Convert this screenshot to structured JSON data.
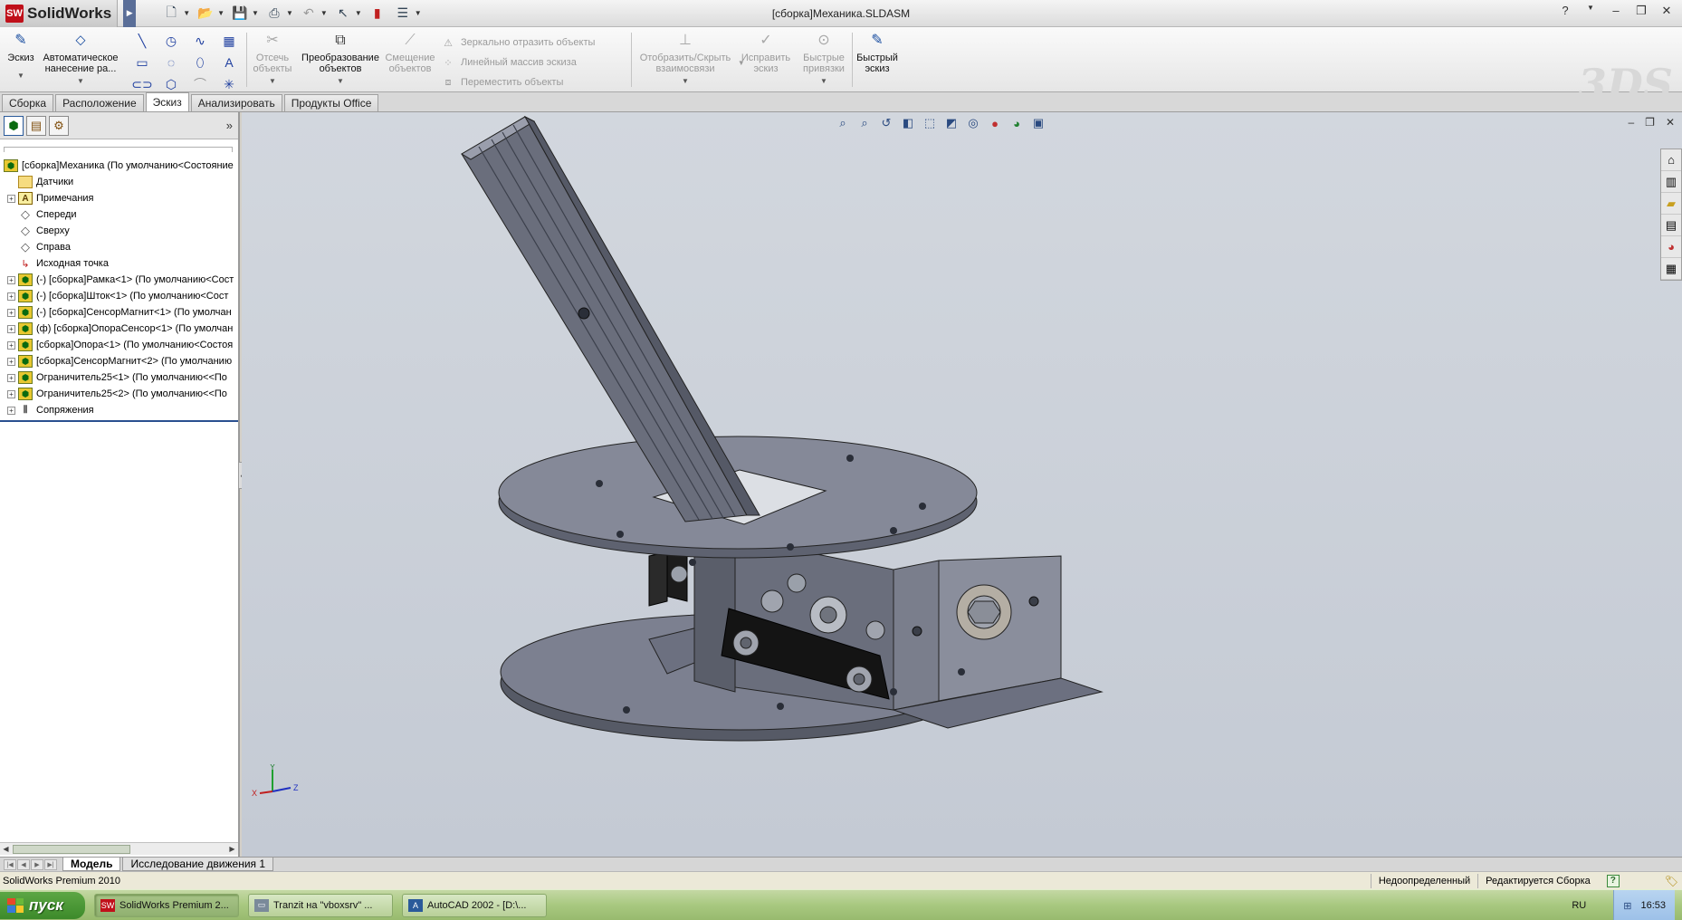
{
  "app": {
    "logo_text": "SolidWorks",
    "doc_title": "[сборка]Механика.SLDASM"
  },
  "command_manager": {
    "sketch": "Эскиз",
    "smart_dim_line1": "Автоматическое",
    "smart_dim_line2": "нанесение ра...",
    "trim_line1": "Отсечь",
    "trim_line2": "объекты",
    "convert_line1": "Преобразование",
    "convert_line2": "объектов",
    "offset_line1": "Смещение",
    "offset_line2": "объектов",
    "mirror": "Зеркально отразить объекты",
    "linear_pattern": "Линейный массив эскиза",
    "move": "Переместить объекты",
    "show_rel_line1": "Отобразить/Скрыть",
    "show_rel_line2": "взаимосвязи",
    "repair_line1": "Исправить",
    "repair_line2": "эскиз",
    "snaps_line1": "Быстрые",
    "snaps_line2": "привязки",
    "rapid_line1": "Быстрый",
    "rapid_line2": "эскиз"
  },
  "tabs": [
    {
      "label": "Сборка"
    },
    {
      "label": "Расположение"
    },
    {
      "label": "Эскиз"
    },
    {
      "label": "Анализировать"
    },
    {
      "label": "Продукты Office"
    }
  ],
  "tree": {
    "root": "[сборка]Механика  (По умолчанию<Состояние",
    "items": [
      {
        "label": "Датчики"
      },
      {
        "label": "Примечания"
      },
      {
        "label": "Спереди"
      },
      {
        "label": "Сверху"
      },
      {
        "label": "Справа"
      },
      {
        "label": "Исходная точка"
      },
      {
        "label": "(-) [сборка]Рамка<1> (По умолчанию<Сост"
      },
      {
        "label": "(-) [сборка]Шток<1> (По умолчанию<Сост"
      },
      {
        "label": "(-) [сборка]СенсорМагнит<1> (По умолчан"
      },
      {
        "label": "(ф) [сборка]ОпораСенсор<1> (По умолчан"
      },
      {
        "label": "[сборка]Опора<1> (По умолчанию<Состоя"
      },
      {
        "label": "[сборка]СенсорМагнит<2> (По умолчанию"
      },
      {
        "label": "Ограничитель25<1> (По умолчанию<<По "
      },
      {
        "label": "Ограничитель25<2> (По умолчанию<<По "
      },
      {
        "label": "Сопряжения"
      }
    ]
  },
  "triad": {
    "x": "X",
    "y": "Y",
    "z": "Z"
  },
  "bottom_tabs": [
    {
      "label": "Модель"
    },
    {
      "label": "Исследование движения 1"
    }
  ],
  "status": {
    "product": "SolidWorks Premium 2010",
    "definition": "Недоопределенный",
    "editing": "Редактируется Сборка"
  },
  "taskbar": {
    "start": "пуск",
    "items": [
      {
        "label": "SolidWorks Premium 2..."
      },
      {
        "label": "Tranzit на \"vboxsrv\" ..."
      },
      {
        "label": "AutoCAD 2002 - [D:\\..."
      }
    ],
    "lang": "RU",
    "clock": "16:53"
  }
}
